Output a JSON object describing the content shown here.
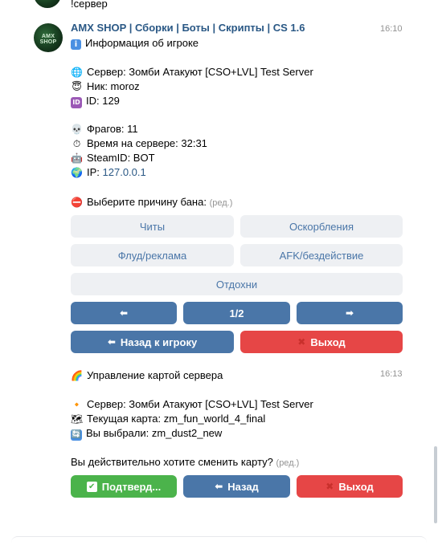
{
  "prev": {
    "text": "!сервер"
  },
  "msg1": {
    "sender": "AMX SHOP | Сборки | Боты | Скрипты | CS 1.6",
    "avatar_text": "AMX SHOP",
    "time": "16:10",
    "title_icon": "info-icon",
    "title": "Информация об игроке",
    "server": "Сервер: Зомби Атакуют [CSO+LVL] Test Server",
    "nick": "Ник: moroz",
    "id": "ID: 129",
    "frags": "Фрагов: 11",
    "playtime": "Время на сервере: 32:31",
    "steamid": "SteamID: BOT",
    "ip_label": "IP: ",
    "ip_value": "127.0.0.1",
    "ban_prompt": "Выберите причину бана:",
    "edited": "(ред.)",
    "buttons": {
      "cheats": "Читы",
      "insults": "Оскорбления",
      "flood": "Флуд/реклама",
      "afk": "AFK/бездействие",
      "rest": "Отдохни",
      "prev": "⬅",
      "page": "1/2",
      "next": "➡",
      "back_to_player": "Назад к игроку",
      "exit": "Выход"
    }
  },
  "msg2": {
    "title": "Управление картой сервера",
    "time": "16:13",
    "server": "Сервер: Зомби Атакуют [CSO+LVL] Test Server",
    "current_map": "Текущая карта: zm_fun_world_4_final",
    "chosen": "Вы выбрали: zm_dust2_new",
    "confirm_prompt": "Вы действительно хотите сменить карту?",
    "edited": "(ред.)",
    "buttons": {
      "confirm": "Подтверд...",
      "back": "Назад",
      "exit": "Выход"
    }
  },
  "colors": {
    "link": "#2a5885",
    "primary": "#4a76a8",
    "negative": "#e64646",
    "positive": "#4bb34b",
    "secondary": "#eef0f3"
  }
}
